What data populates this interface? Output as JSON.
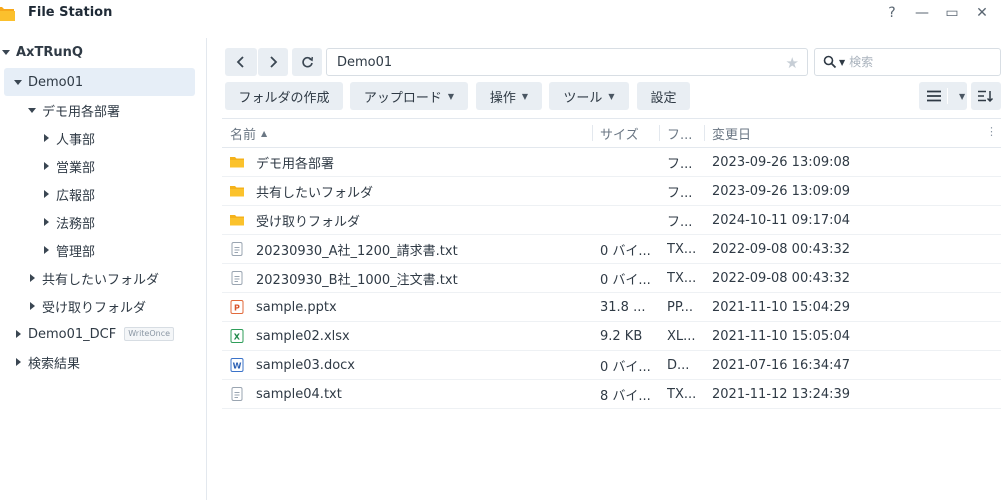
{
  "app": {
    "title": "File Station"
  },
  "window": {
    "help": "?",
    "minimize": "—",
    "maximize": "▭",
    "close": "✕"
  },
  "sidebar": {
    "root": {
      "label": "AxTRunQ"
    },
    "items": [
      {
        "label": "Demo01"
      },
      {
        "label": "デモ用各部署"
      },
      {
        "label": "人事部"
      },
      {
        "label": "営業部"
      },
      {
        "label": "広報部"
      },
      {
        "label": "法務部"
      },
      {
        "label": "管理部"
      },
      {
        "label": "共有したいフォルダ"
      },
      {
        "label": "受け取りフォルダ"
      },
      {
        "label": "Demo01_DCF",
        "badge": "WriteOnce"
      },
      {
        "label": "検索結果"
      }
    ]
  },
  "nav": {
    "path": "Demo01",
    "search_placeholder": "検索"
  },
  "toolbar": {
    "create_folder": "フォルダの作成",
    "upload": "アップロード",
    "action": "操作",
    "tools": "ツール",
    "settings": "設定"
  },
  "table": {
    "headers": {
      "name": "名前",
      "size": "サイズ",
      "type": "フ...",
      "modified": "変更日"
    },
    "rows": [
      {
        "name": "デモ用各部署",
        "size": "",
        "type": "フ...",
        "modified": "2023-09-26 13:09:08",
        "icon": "folder-icon"
      },
      {
        "name": "共有したいフォルダ",
        "size": "",
        "type": "フ...",
        "modified": "2023-09-26 13:09:09",
        "icon": "folder-icon"
      },
      {
        "name": "受け取りフォルダ",
        "size": "",
        "type": "フ...",
        "modified": "2024-10-11 09:17:04",
        "icon": "folder-icon"
      },
      {
        "name": "20230930_A社_1200_請求書.txt",
        "size": "0 バイ...",
        "type": "TX...",
        "modified": "2022-09-08 00:43:32",
        "icon": "text-file-icon"
      },
      {
        "name": "20230930_B社_1000_注文書.txt",
        "size": "0 バイ...",
        "type": "TX...",
        "modified": "2022-09-08 00:43:32",
        "icon": "text-file-icon"
      },
      {
        "name": "sample.pptx",
        "size": "31.8 ...",
        "type": "PP...",
        "modified": "2021-11-10 15:04:29",
        "icon": "powerpoint-file-icon"
      },
      {
        "name": "sample02.xlsx",
        "size": "9.2 KB",
        "type": "XL...",
        "modified": "2021-11-10 15:05:04",
        "icon": "excel-file-icon"
      },
      {
        "name": "sample03.docx",
        "size": "0 バイ...",
        "type": "D...",
        "modified": "2021-07-16 16:34:47",
        "icon": "word-file-icon"
      },
      {
        "name": "sample04.txt",
        "size": "8 バイ...",
        "type": "TX...",
        "modified": "2021-11-12 13:24:39",
        "icon": "text-file-icon"
      }
    ]
  },
  "colors": {
    "accent": "#2b7ad6",
    "folder": "#f5b21b",
    "selected_bg": "#e6eef7",
    "button_bg": "#e9eef3"
  }
}
